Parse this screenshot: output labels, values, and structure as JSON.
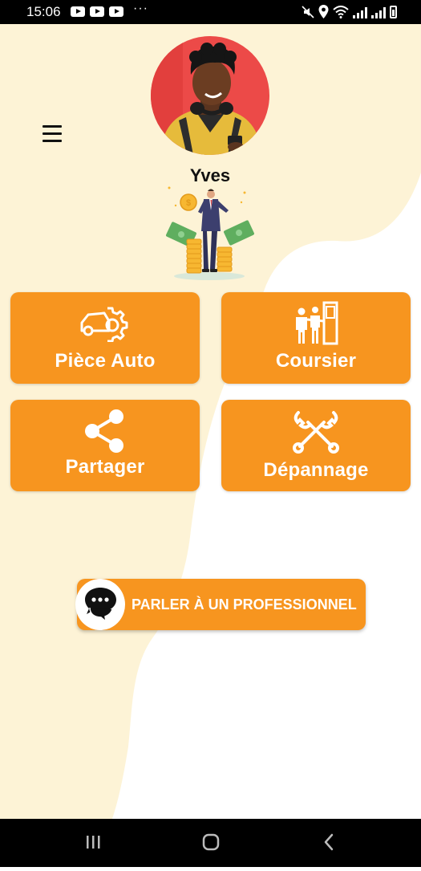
{
  "status_bar": {
    "time": "15:06",
    "more": "···",
    "icons": [
      "youtube-icon",
      "youtube-icon",
      "youtube-icon",
      "mute-icon",
      "location-icon",
      "wifi-icon",
      "signal-icon",
      "signal-icon",
      "battery-icon"
    ]
  },
  "profile": {
    "name": "Yves"
  },
  "cards": [
    {
      "label": "Pièce Auto",
      "icon": "car-gear-icon"
    },
    {
      "label": "Coursier",
      "icon": "courier-door-icon"
    },
    {
      "label": "Partager",
      "icon": "share-icon"
    },
    {
      "label": "Dépannage",
      "icon": "wrench-icon"
    }
  ],
  "talk_button": {
    "label": "PARLER À UN PROFESSIONNEL",
    "icon": "chat-icon"
  },
  "nav": [
    "recents-icon",
    "home-icon",
    "back-icon"
  ],
  "colors": {
    "accent": "#f7951f",
    "background_wave": "#fdf3d6",
    "text": "#111111"
  }
}
